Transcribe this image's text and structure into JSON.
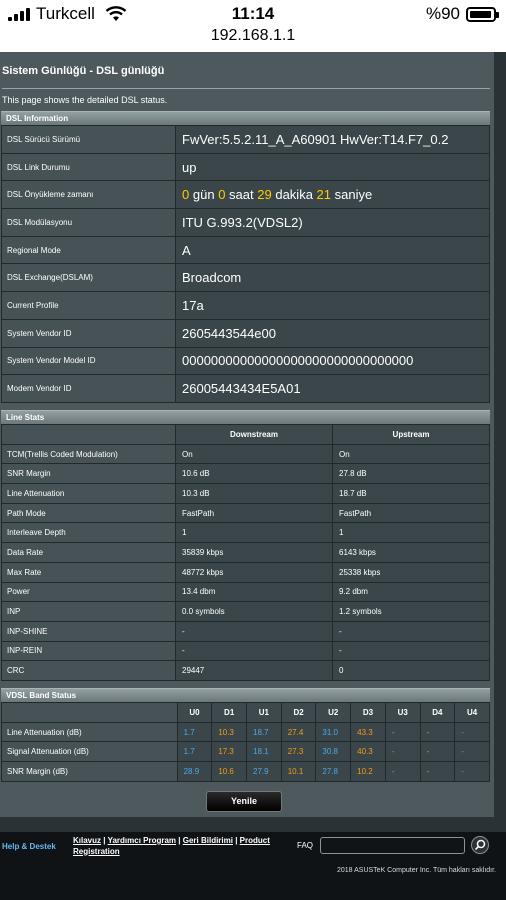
{
  "status_bar": {
    "carrier": "Turkcell",
    "time": "11:14",
    "url": "192.168.1.1",
    "battery": "%90",
    "battery_level": 0.9
  },
  "page": {
    "title": "Sistem Günlüğü - DSL günlüğü",
    "description": "This page shows the detailed DSL status."
  },
  "dsl_info": {
    "header": "DSL Information",
    "rows": [
      {
        "label": "DSL Sürücü Sürümü",
        "value": "FwVer:5.5.2.11_A_A60901 HwVer:T14.F7_0.2"
      },
      {
        "label": "DSL Link Durumu",
        "value": "up"
      },
      {
        "label": "DSL Önyükleme zamanı",
        "value": ""
      },
      {
        "label": "DSL Modülasyonu",
        "value": "ITU G.993.2(VDSL2)"
      },
      {
        "label": "Regional Mode",
        "value": "A"
      },
      {
        "label": "DSL Exchange(DSLAM)",
        "value": "Broadcom"
      },
      {
        "label": "Current Profile",
        "value": "17a"
      },
      {
        "label": "System Vendor ID",
        "value": "2605443544e00"
      },
      {
        "label": "System Vendor Model ID",
        "value": "00000000000000000000000000000000"
      },
      {
        "label": "Modem Vendor ID",
        "value": "26005443434E5A01"
      }
    ],
    "uptime": {
      "days": "0",
      "days_unit": "gün",
      "hours": "0",
      "hours_unit": "saat",
      "minutes": "29",
      "minutes_unit": "dakika",
      "seconds": "21",
      "seconds_unit": "saniye"
    }
  },
  "line_stats": {
    "header": "Line Stats",
    "columns": [
      "Downstream",
      "Upstream"
    ],
    "rows": [
      {
        "label": "TCM(Trellis Coded Modulation)",
        "down": "On",
        "up": "On"
      },
      {
        "label": "SNR Margin",
        "down": "10.6 dB",
        "up": "27.8 dB"
      },
      {
        "label": "Line Attenuation",
        "down": "10.3 dB",
        "up": "18.7 dB"
      },
      {
        "label": "Path Mode",
        "down": "FastPath",
        "up": "FastPath"
      },
      {
        "label": "Interleave Depth",
        "down": "1",
        "up": "1"
      },
      {
        "label": "Data Rate",
        "down": "35839 kbps",
        "up": "6143 kbps"
      },
      {
        "label": "Max Rate",
        "down": "48772 kbps",
        "up": "25338 kbps"
      },
      {
        "label": "Power",
        "down": "13.4 dbm",
        "up": "9.2 dbm"
      },
      {
        "label": "INP",
        "down": "0.0 symbols",
        "up": "1.2 symbols"
      },
      {
        "label": "INP-SHINE",
        "down": "-",
        "up": "-"
      },
      {
        "label": "INP-REIN",
        "down": "-",
        "up": "-"
      },
      {
        "label": "CRC",
        "down": "29447",
        "up": "0"
      }
    ]
  },
  "band_status": {
    "header": "VDSL Band Status",
    "bands": [
      "U0",
      "D1",
      "U1",
      "D2",
      "U2",
      "D3",
      "U3",
      "D4",
      "U4"
    ],
    "rows": [
      {
        "label": "Line Attenuation (dB)",
        "values": [
          "1.7",
          "10.3",
          "18.7",
          "27.4",
          "31.0",
          "43.3",
          "-",
          "-",
          "-"
        ]
      },
      {
        "label": "Signal Attenuation (dB)",
        "values": [
          "1.7",
          "17.3",
          "18.1",
          "27.3",
          "30.8",
          "40.3",
          "-",
          "-",
          "-"
        ]
      },
      {
        "label": "SNR Margin (dB)",
        "values": [
          "28.9",
          "10.6",
          "27.9",
          "10.1",
          "27.8",
          "10.2",
          "-",
          "-",
          "-"
        ]
      }
    ],
    "colors": {
      "upstream": "#4aa8e8",
      "downstream": "#f39c12"
    }
  },
  "refresh_button": "Yenile",
  "footer": {
    "help": "Help & Destek",
    "links": [
      "Kılavuz",
      "Yardımcı Program",
      "Geri Bildirimi",
      "Product Registration"
    ],
    "separator": " | ",
    "faq": "FAQ",
    "faq_placeholder": "",
    "copyright": "2018 ASUSTeK Computer Inc. Tüm hakları saklıdır."
  }
}
